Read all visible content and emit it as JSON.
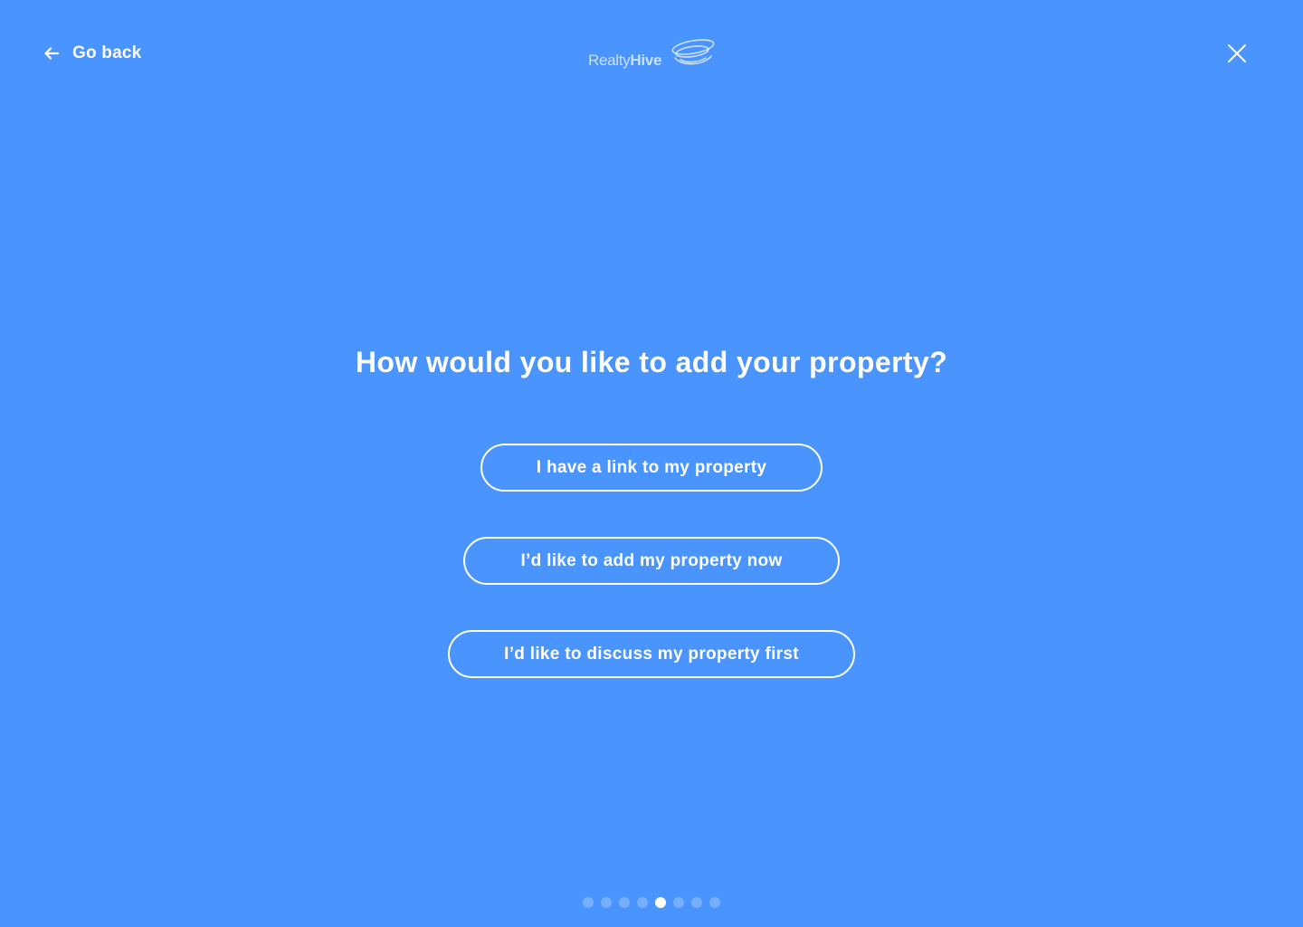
{
  "header": {
    "back_label": "Go back",
    "back_icon": "arrow-left-icon",
    "logo": {
      "text_light": "Realty",
      "text_bold": "Hive",
      "icon": "swirl-logo-icon"
    },
    "close_icon": "close-icon"
  },
  "main": {
    "question": "How would you like to add your property?",
    "options": [
      {
        "label": "I have a link to my property"
      },
      {
        "label": "I’d like to add my property now"
      },
      {
        "label": "I’d like to discuss my property first"
      }
    ]
  },
  "pagination": {
    "total_steps": 8,
    "current_step": 5
  },
  "colors": {
    "background": "#4a94ff",
    "foreground": "#ffffff"
  }
}
